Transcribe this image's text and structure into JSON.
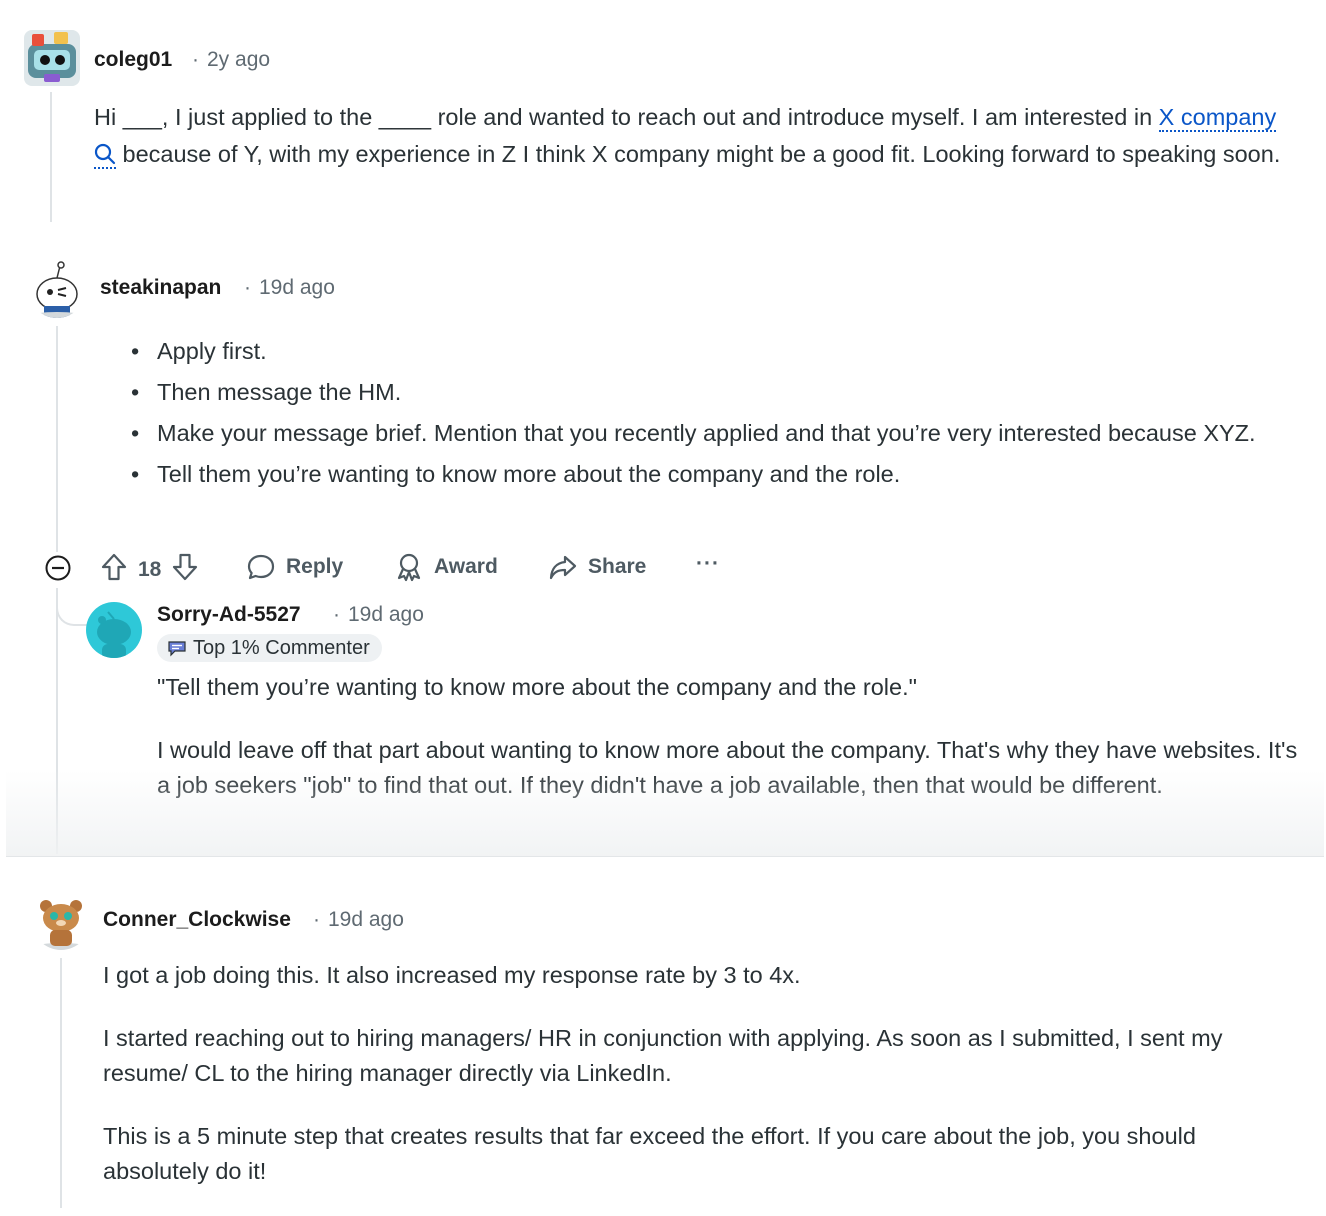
{
  "comments": [
    {
      "username": "coleg01",
      "age": "2y ago",
      "body_parts": [
        "Hi ___, I just applied to the ____ role and wanted to reach out and introduce myself. I am interested in ",
        "X company",
        " because of Y, with my experience in Z I think X company might be a good fit. Looking forward to speaking soon."
      ]
    },
    {
      "username": "steakinapan",
      "age": "19d ago",
      "bullets": [
        "Apply first.",
        "Then message the HM.",
        "Make your message brief. Mention that you recently applied and that you’re very interested because XYZ.",
        "Tell them you’re wanting to know more about the company and the role."
      ],
      "actions": {
        "upvotes": "18",
        "reply_label": "Reply",
        "award_label": "Award",
        "share_label": "Share",
        "more_label": "···"
      }
    },
    {
      "username": "Sorry-Ad-5527",
      "age": "19d ago",
      "badge": "Top 1% Commenter",
      "paragraphs": [
        "\"Tell them you’re wanting to know more about the company and the role.\"",
        "I would leave off that part about wanting to know more about the company. That's why they have websites. It's a job seekers \"job\" to find that out. If they didn't have a job available, then that would be different."
      ]
    },
    {
      "username": "Conner_Clockwise",
      "age": "19d ago",
      "paragraphs": [
        "I got a job doing this. It also increased my response rate by 3 to 4x.",
        "I started reaching out to hiring managers/ HR in conjunction with applying. As soon as I submitted, I sent my resume/ CL to the hiring manager directly via LinkedIn.",
        "This is a 5 minute step that creates results that far exceed the effort. If you care about the job, you should absolutely do it!"
      ]
    }
  ],
  "colors": {
    "link": "#0a56c8",
    "meta_text": "#5f6a72",
    "thread_line": "#dfe3e6",
    "badge_bg": "#eef1f3"
  }
}
